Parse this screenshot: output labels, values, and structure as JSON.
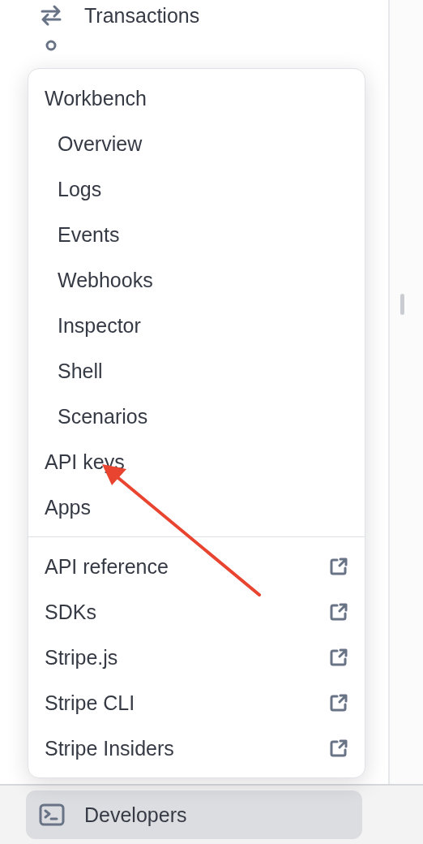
{
  "sidebar": {
    "items": [
      {
        "label": "Transactions"
      }
    ]
  },
  "menu": {
    "items": [
      {
        "label": "Workbench",
        "children": [
          {
            "label": "Overview"
          },
          {
            "label": "Logs"
          },
          {
            "label": "Events"
          },
          {
            "label": "Webhooks"
          },
          {
            "label": "Inspector"
          },
          {
            "label": "Shell"
          },
          {
            "label": "Scenarios"
          }
        ]
      },
      {
        "label": "API keys"
      },
      {
        "label": "Apps"
      }
    ],
    "links": [
      {
        "label": "API reference"
      },
      {
        "label": "SDKs"
      },
      {
        "label": "Stripe.js"
      },
      {
        "label": "Stripe CLI"
      },
      {
        "label": "Stripe Insiders"
      }
    ]
  },
  "footer": {
    "label": "Developers",
    "selected": true
  }
}
